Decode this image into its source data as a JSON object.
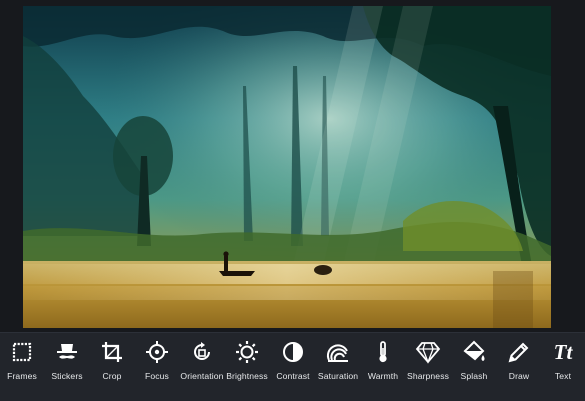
{
  "toolbar": {
    "tools": [
      {
        "label": "Frames",
        "icon": "frames-icon"
      },
      {
        "label": "Stickers",
        "icon": "stickers-icon"
      },
      {
        "label": "Crop",
        "icon": "crop-icon"
      },
      {
        "label": "Focus",
        "icon": "focus-icon"
      },
      {
        "label": "Orientation",
        "icon": "orientation-icon"
      },
      {
        "label": "Brightness",
        "icon": "brightness-icon"
      },
      {
        "label": "Contrast",
        "icon": "contrast-icon"
      },
      {
        "label": "Saturation",
        "icon": "saturation-icon"
      },
      {
        "label": "Warmth",
        "icon": "warmth-icon"
      },
      {
        "label": "Sharpness",
        "icon": "sharpness-icon"
      },
      {
        "label": "Splash",
        "icon": "splash-icon"
      },
      {
        "label": "Draw",
        "icon": "draw-icon"
      },
      {
        "label": "Text",
        "icon": "text-icon",
        "glyph": "Tt"
      }
    ]
  },
  "colors": {
    "toolbar_bg": "#22252b",
    "icon": "#ffffff",
    "label": "#e6e8ea"
  }
}
